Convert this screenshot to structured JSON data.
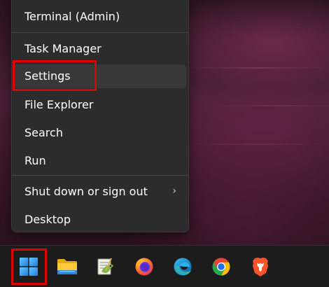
{
  "menu": {
    "items": [
      {
        "label": "Terminal (Admin)"
      },
      {
        "label": "Task Manager"
      },
      {
        "label": "Settings"
      },
      {
        "label": "File Explorer"
      },
      {
        "label": "Search"
      },
      {
        "label": "Run"
      },
      {
        "label": "Shut down or sign out",
        "submenu_indicator": "›"
      },
      {
        "label": "Desktop"
      }
    ],
    "highlighted_item": "Settings"
  },
  "taskbar": {
    "icons": [
      {
        "name": "start-windows-icon",
        "highlighted": true
      },
      {
        "name": "file-explorer-icon"
      },
      {
        "name": "notepad-plus-plus-icon"
      },
      {
        "name": "firefox-icon"
      },
      {
        "name": "edge-icon"
      },
      {
        "name": "chrome-icon"
      },
      {
        "name": "brave-icon"
      }
    ]
  },
  "colors": {
    "highlight_border": "#e00000",
    "menu_background": "#2c2c2c",
    "taskbar_background": "#1c1c1c",
    "windows_blue": "#3ea0f5"
  }
}
